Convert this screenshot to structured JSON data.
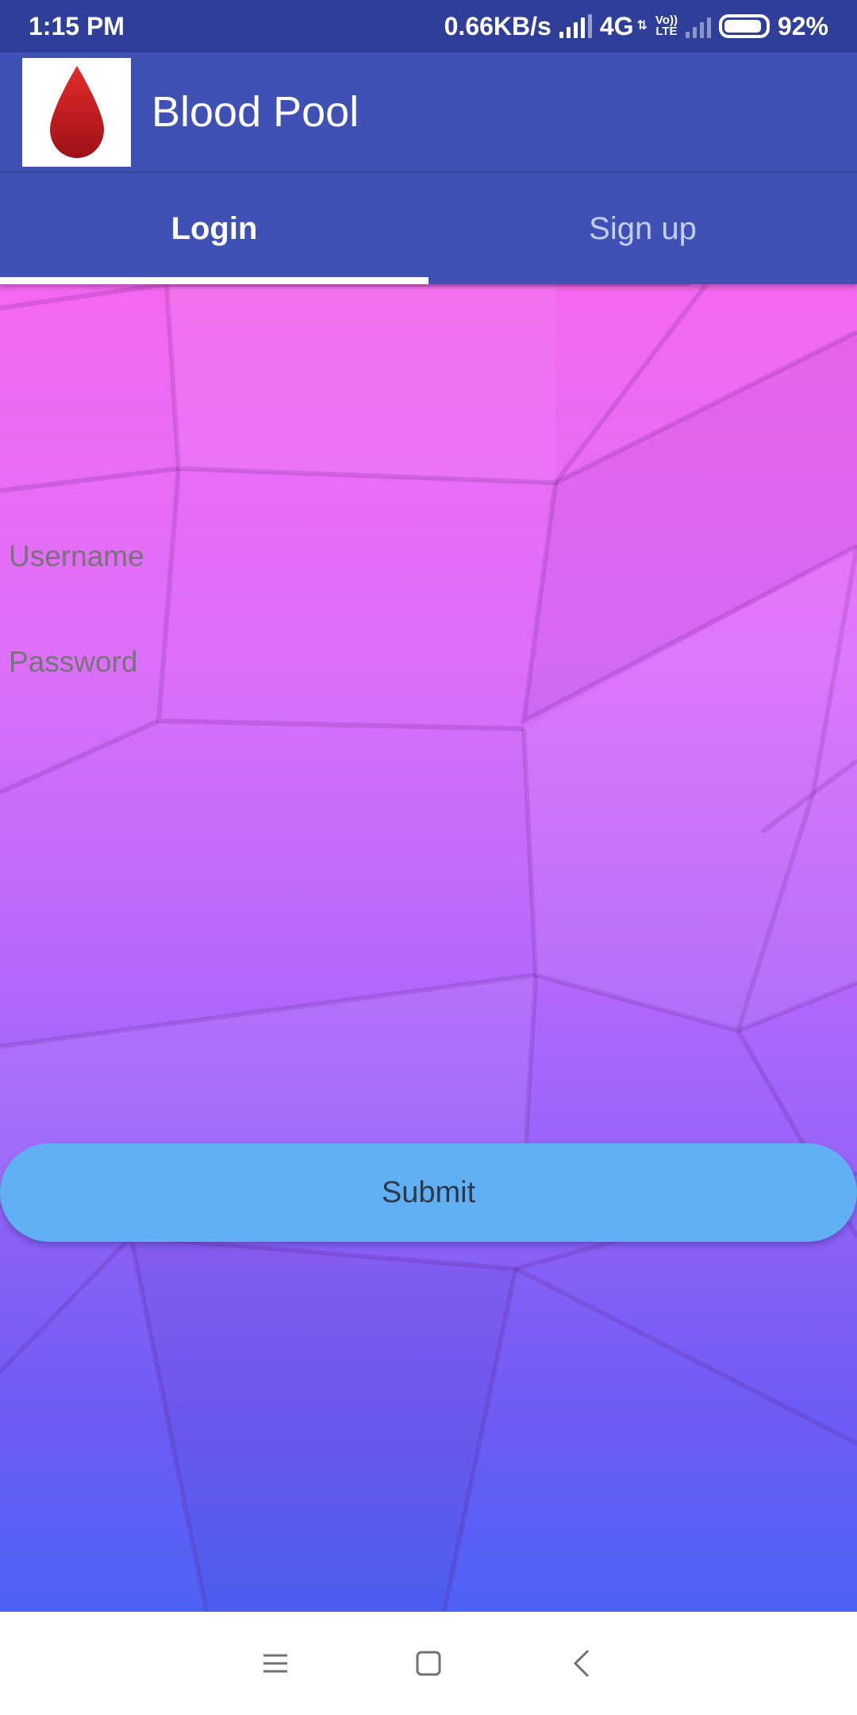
{
  "status_bar": {
    "time": "1:15 PM",
    "speed": "0.66KB/s",
    "network": "4G",
    "volte_top": "Vo))",
    "volte_bottom": "LTE",
    "battery_percent": "92%",
    "battery_level": 0.92
  },
  "app_bar": {
    "title": "Blood Pool",
    "logo_icon": "blood-drop-icon",
    "logo_color": "#c8161d"
  },
  "tabs": [
    {
      "label": "Login",
      "active": true
    },
    {
      "label": "Sign up",
      "active": false
    }
  ],
  "form": {
    "username_placeholder": "Username",
    "username_value": "",
    "password_placeholder": "Password",
    "password_value": "",
    "submit_label": "Submit"
  },
  "nav_bar": {
    "icons": [
      "menu-icon",
      "home-square-icon",
      "back-chevron-icon"
    ]
  },
  "colors": {
    "primary": "#3f51b5",
    "status_bar": "#2f3f99",
    "submit": "#62b0f4",
    "gradient_top": "#f468ee",
    "gradient_bottom": "#4d63f6"
  }
}
